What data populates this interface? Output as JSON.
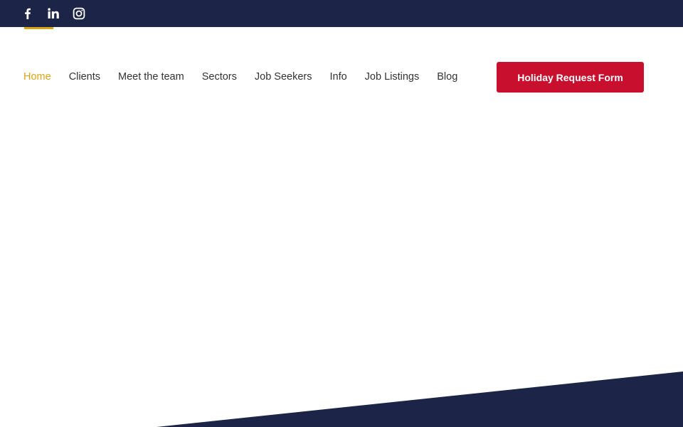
{
  "colors": {
    "topbar": "#1c2548",
    "accent": "#d9a514",
    "cta": "#c8102e",
    "text": "#333333",
    "footer_band": "#1c2548"
  },
  "social": {
    "icons": [
      "facebook-icon",
      "linkedin-icon",
      "instagram-icon"
    ]
  },
  "nav": {
    "items": [
      {
        "label": "Home",
        "active": true
      },
      {
        "label": "Clients"
      },
      {
        "label": "Meet the team"
      },
      {
        "label": "Sectors"
      },
      {
        "label": "Job Seekers"
      },
      {
        "label": "Info"
      },
      {
        "label": "Job Listings"
      },
      {
        "label": "Blog"
      }
    ],
    "cta_label": "Holiday Request Form"
  }
}
